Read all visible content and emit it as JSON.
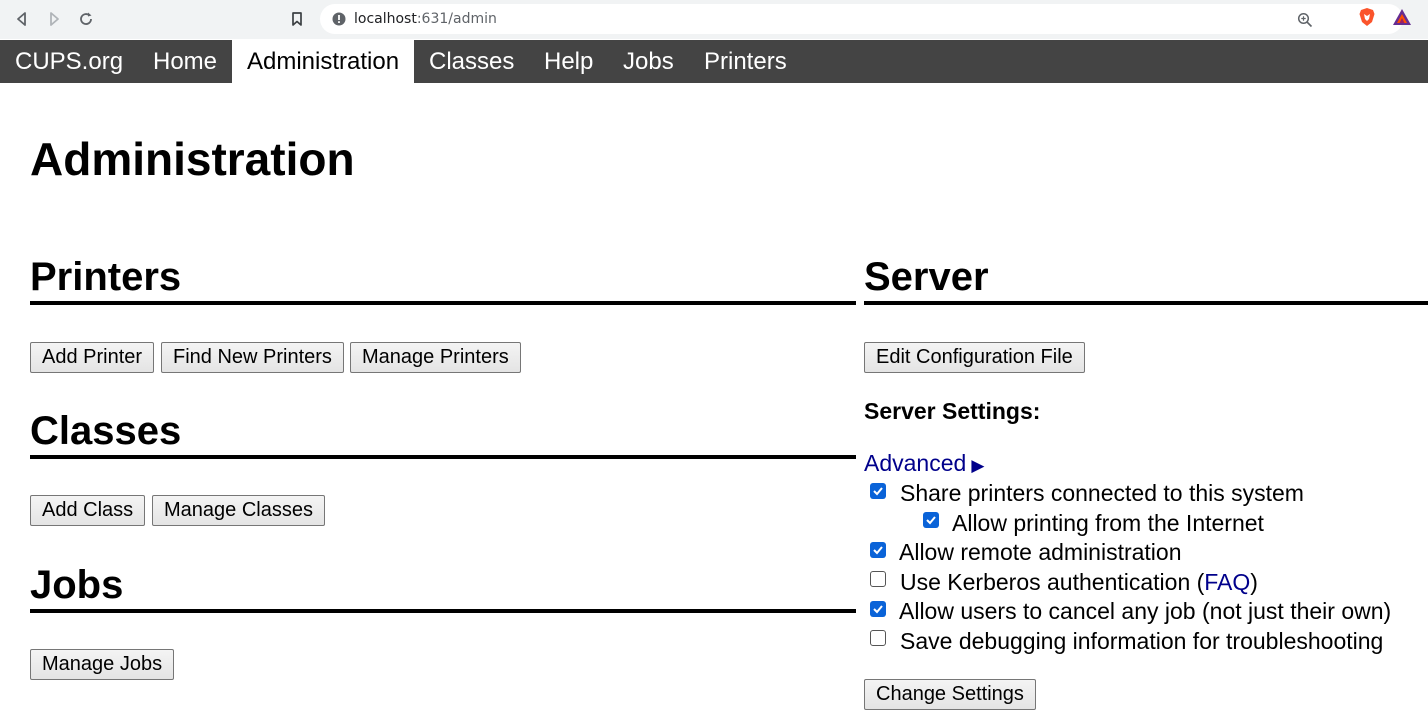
{
  "browser": {
    "url_host": "localhost",
    "url_path": ":631/admin"
  },
  "nav": {
    "tabs": [
      {
        "label": "CUPS.org",
        "active": false
      },
      {
        "label": "Home",
        "active": false
      },
      {
        "label": "Administration",
        "active": true
      },
      {
        "label": "Classes",
        "active": false
      },
      {
        "label": "Help",
        "active": false
      },
      {
        "label": "Jobs",
        "active": false
      },
      {
        "label": "Printers",
        "active": false
      }
    ]
  },
  "page": {
    "title": "Administration"
  },
  "printers": {
    "heading": "Printers",
    "buttons": [
      "Add Printer",
      "Find New Printers",
      "Manage Printers"
    ]
  },
  "classes": {
    "heading": "Classes",
    "buttons": [
      "Add Class",
      "Manage Classes"
    ]
  },
  "jobs": {
    "heading": "Jobs",
    "buttons": [
      "Manage Jobs"
    ]
  },
  "server": {
    "heading": "Server",
    "edit_config_label": "Edit Configuration File",
    "settings_label": "Server Settings:",
    "advanced_label": "Advanced",
    "advanced_arrow": "▶",
    "options": [
      {
        "label": "Share printers connected to this system",
        "checked": true
      },
      {
        "label": "Allow printing from the Internet",
        "checked": true
      },
      {
        "label": "Allow remote administration",
        "checked": true
      },
      {
        "label_before": "Use Kerberos authentication (",
        "link": "FAQ",
        "label_after": ")",
        "checked": false
      },
      {
        "label": "Allow users to cancel any job (not just their own)",
        "checked": true
      },
      {
        "label": "Save debugging information for troubleshooting",
        "checked": false
      }
    ],
    "change_settings_label": "Change Settings"
  },
  "colors": {
    "nav_bg": "#444444",
    "link": "#00008b",
    "checkbox": "#0a63d8"
  }
}
